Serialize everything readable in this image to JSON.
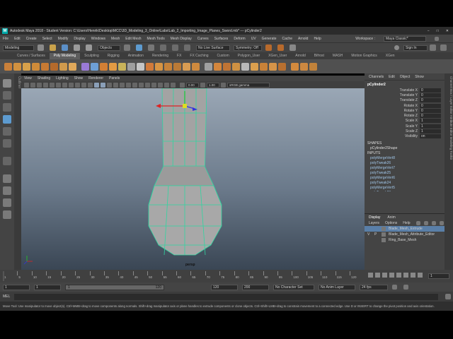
{
  "window": {
    "title": "Autodesk Maya 2018 - Student Version: C:\\Users\\Henrik\\Desktop\\MCC\\3D_Modeling_3_Online\\Labs\\Lab_2_Importing_Image_Planes_Sword.mb* --- pCylinder2",
    "controls": [
      "−",
      "□",
      "✕"
    ]
  },
  "menubar": {
    "items": [
      "File",
      "Edit",
      "Create",
      "Select",
      "Modify",
      "Display",
      "Windows",
      "Mesh",
      "Edit Mesh",
      "Mesh Tools",
      "Mesh Display",
      "Curves",
      "Surfaces",
      "Deform",
      "UV",
      "Generate",
      "Cache",
      "Arnold",
      "Help"
    ],
    "workspace_label": "Workspace :",
    "workspace_value": "Maya Classic*"
  },
  "statusline": {
    "mode": "Modeling",
    "objects": "Objects",
    "live_surface": "No Live Surface",
    "symmetry": "Symmetry: Off",
    "sign_in": "Sign In"
  },
  "shelf": {
    "tabs": [
      "Curves / Surfaces",
      "Poly Modeling",
      "Sculpting",
      "Rigging",
      "Animation",
      "Rendering",
      "FX",
      "FX Caching",
      "Custom",
      "Polygon_User",
      "XGen_User",
      "Arnold",
      "Bifrost",
      "MASH",
      "Motion Graphics",
      "XGen"
    ],
    "active_tab": "Poly Modeling",
    "icon_colors": [
      "#c9803a",
      "#d1913f",
      "#d8a14a",
      "#cf8b39",
      "#c77a33",
      "#b56a2b",
      "#d09a4c",
      "#e1a95a",
      "#9a7ad6",
      "#6ea0d6",
      "#d37f34",
      "#e39b43",
      "#c9b35a",
      "#9f9f9f",
      "#c6c6c6",
      "#d17a3a",
      "#d79443",
      "#c6823a",
      "#bb7a36",
      "#d99c52",
      "#cf8a3e",
      "#a0a0a0",
      "#d4863c",
      "#c07434",
      "#cf9142",
      "#b9b9b9",
      "#dca04e",
      "#c98238",
      "#d69448",
      "#b87030",
      "#d38a3d",
      "#cc8840",
      "#c1823a"
    ]
  },
  "viewport": {
    "menu": [
      "View",
      "Shading",
      "Lighting",
      "Show",
      "Renderer",
      "Panels"
    ],
    "exposure": "0.00",
    "gamma": "1.00",
    "colorspace": "sRGB gamma",
    "camera": "persp"
  },
  "channel_box": {
    "tabs": [
      "Channels",
      "Edit",
      "Object",
      "Show"
    ],
    "node": "pCylinder2",
    "attributes": [
      {
        "name": "Translate X",
        "value": "0"
      },
      {
        "name": "Translate Y",
        "value": "0"
      },
      {
        "name": "Translate Z",
        "value": "0"
      },
      {
        "name": "Rotate X",
        "value": "0"
      },
      {
        "name": "Rotate Y",
        "value": "0"
      },
      {
        "name": "Rotate Z",
        "value": "0"
      },
      {
        "name": "Scale X",
        "value": "1"
      },
      {
        "name": "Scale Y",
        "value": "1"
      },
      {
        "name": "Scale Z",
        "value": "1"
      },
      {
        "name": "Visibility",
        "value": "on"
      }
    ],
    "shapes_label": "SHAPES",
    "shape": "pCylinder2Shape",
    "inputs_label": "INPUTS",
    "inputs": [
      "polyMergeVert8",
      "polyTweak26",
      "polyMergeVert7",
      "polyTweak25",
      "polyMergeVert6",
      "polyTweak24",
      "polyMergeVert5",
      "polyTweak23",
      "polyMergeVert4",
      "polyTweak22",
      "polyMergeVert3"
    ]
  },
  "layer_editor": {
    "tabs": [
      "Display",
      "Anim"
    ],
    "menu": [
      "Layers",
      "Options",
      "Help"
    ],
    "layers": [
      {
        "v": "",
        "p": "",
        "name": "Blade_Mesh_Extrude",
        "selected": true
      },
      {
        "v": "V",
        "p": "P",
        "name": "Blade_Mesh_Attribute_Editor",
        "selected": false
      },
      {
        "v": "",
        "p": "",
        "name": "Ring_Base_Mesh",
        "selected": false
      }
    ]
  },
  "side_tabs": "Channel Box / Layer Editor    Attribute Editor    Modeling Toolkit",
  "outliner_tab": "Outliner",
  "timeline": {
    "ticks": [
      "1",
      "5",
      "10",
      "15",
      "20",
      "25",
      "30",
      "35",
      "40",
      "45",
      "50",
      "55",
      "60",
      "65",
      "70",
      "75",
      "80",
      "85",
      "90",
      "95",
      "100",
      "105",
      "110",
      "115",
      "120"
    ],
    "current_frame": "1"
  },
  "range": {
    "start": "1",
    "anim_start": "1",
    "slider_left": "1",
    "slider_right": "120",
    "anim_end_field": "120",
    "end": "120",
    "max": "200",
    "character_set": "No Character Set",
    "anim_layer": "No Anim Layer",
    "fps": "24 fps"
  },
  "mel": {
    "label": "MEL"
  },
  "help_line": "Move Tool: Use manipulator to move object(s). Ctrl+MMB+drag to move components along normals. Shift+drag manipulator axis or plane handles to extrude components or clone objects. Ctrl+Shift+LMB+drag to constrain movement to a connected edge. Use D or INSERT to change the pivot position and axis orientation."
}
